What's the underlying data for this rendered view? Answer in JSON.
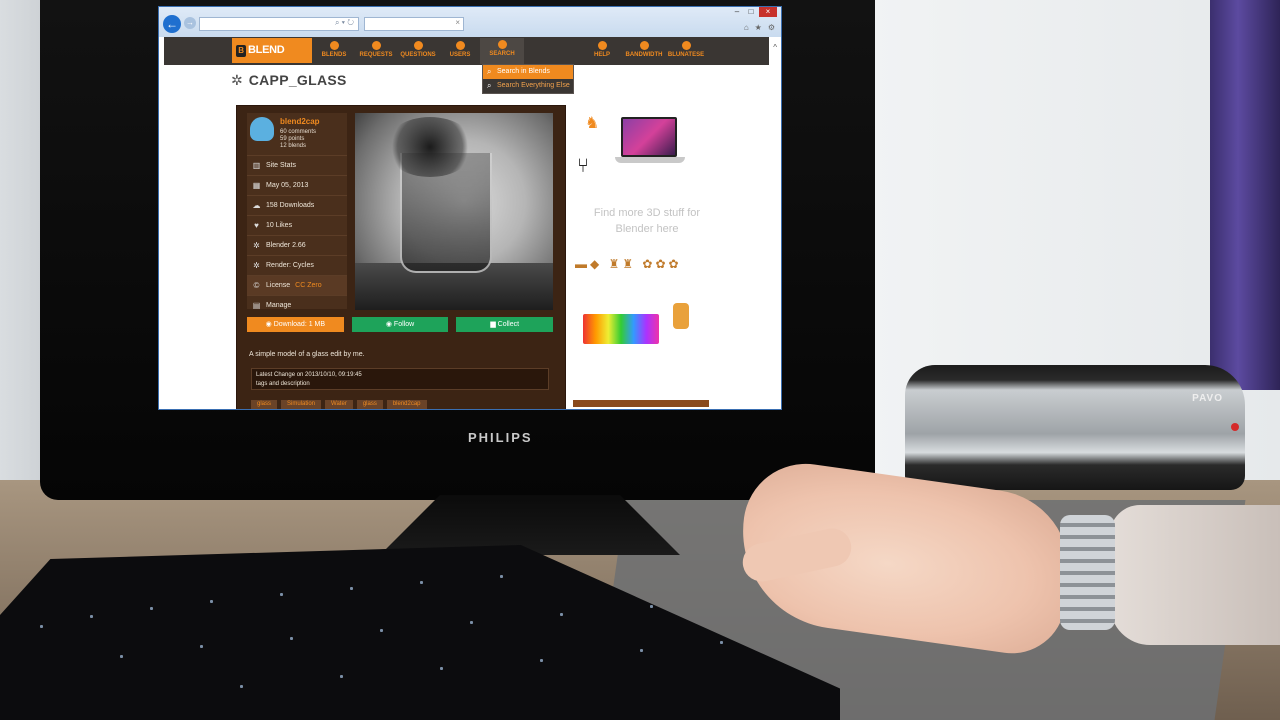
{
  "browser": {
    "back_glyph": "←",
    "forward_glyph": "→",
    "address_icons": "⌕ ▾ ↻",
    "tab_close": "×",
    "window_controls": [
      "–",
      "□",
      "×"
    ],
    "toolbar_icons": [
      "⌂",
      "★",
      "⚙"
    ]
  },
  "site": {
    "logo_mark": "B",
    "logo_text": "BLEND SWAP",
    "nav": [
      {
        "label": "BLENDS",
        "icon": "blend-icon"
      },
      {
        "label": "REQUESTS",
        "icon": "request-icon"
      },
      {
        "label": "QUESTIONS",
        "icon": "question-icon"
      },
      {
        "label": "USERS",
        "icon": "users-icon"
      },
      {
        "label": "SEARCH",
        "icon": "search-icon"
      },
      {
        "label": "HELP",
        "icon": "help-icon"
      },
      {
        "label": "BANDWIDTH",
        "icon": "bandwidth-icon"
      },
      {
        "label": "BLUNATESE",
        "icon": "user-icon"
      }
    ],
    "search_dropdown": [
      "Search in Blends",
      "Search Everything Else"
    ]
  },
  "blend": {
    "title": "CAPP_GLASS",
    "user": {
      "name": "blend2cap",
      "comments": "60 comments",
      "points": "59 points",
      "blends": "12 blends"
    },
    "stats": [
      {
        "icon": "chart-icon",
        "glyph": "▥",
        "label": "Site Stats"
      },
      {
        "icon": "calendar-icon",
        "glyph": "▦",
        "label": "May 05, 2013"
      },
      {
        "icon": "cloud-download-icon",
        "glyph": "☁",
        "label": "158 Downloads"
      },
      {
        "icon": "heart-icon",
        "glyph": "♥",
        "label": "10 Likes"
      },
      {
        "icon": "blender-icon",
        "glyph": "✲",
        "label": "Blender 2.66"
      },
      {
        "icon": "render-icon",
        "glyph": "✲",
        "label": "Render: Cycles"
      }
    ],
    "license_label": "License",
    "license_value": "CC Zero",
    "manage_label": "Manage",
    "download_btn": "Download: 1 MB",
    "follow_btn": "Follow",
    "collect_btn": "Collect",
    "description": "A simple model of a glass edit by me.",
    "change_line1": "Latest Change on 2013/10/10, 09:19:45",
    "change_line2": "tags and description",
    "tags": [
      "glass",
      "Simulation",
      "Water",
      "glass",
      "blend2cap"
    ]
  },
  "ad": {
    "text": "Find more 3D stuff for Blender here"
  },
  "hardware": {
    "monitor_brand": "PHILIPS",
    "laminator_brand": "PAVO"
  }
}
